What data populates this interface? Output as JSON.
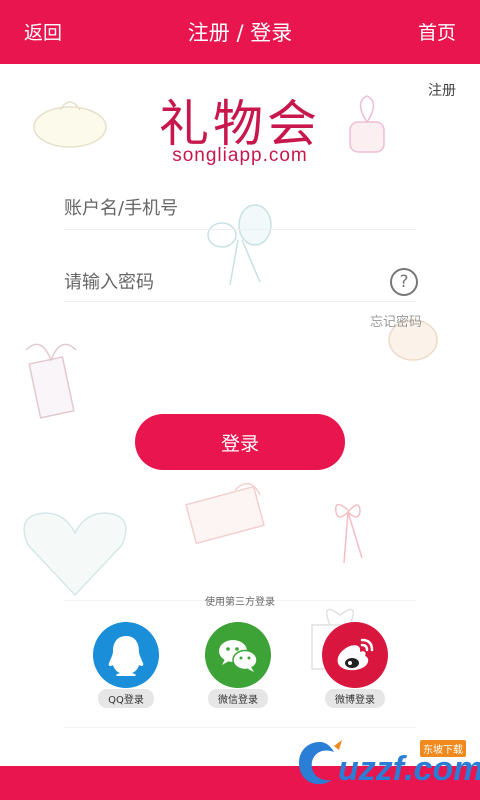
{
  "header": {
    "back_label": "返回",
    "title": "注册 / 登录",
    "home_label": "首页"
  },
  "register_label": "注册",
  "logo": {
    "title": "礼物会",
    "url": "songliapp.com"
  },
  "form": {
    "username_placeholder": "账户名/手机号",
    "password_placeholder": "请输入密码",
    "help_glyph": "?",
    "forgot_label": "忘记密码",
    "login_label": "登录"
  },
  "third_party": {
    "title": "使用第三方登录",
    "providers": [
      {
        "name": "qq",
        "label": "QQ登录"
      },
      {
        "name": "wechat",
        "label": "微信登录"
      },
      {
        "name": "weibo",
        "label": "微博登录"
      }
    ]
  },
  "watermark": {
    "text": "uzzf.com",
    "tag": "东坡下载"
  },
  "colors": {
    "accent": "#e8154f",
    "qq": "#1a8ed9",
    "wechat": "#3da336",
    "weibo": "#d8163e"
  }
}
